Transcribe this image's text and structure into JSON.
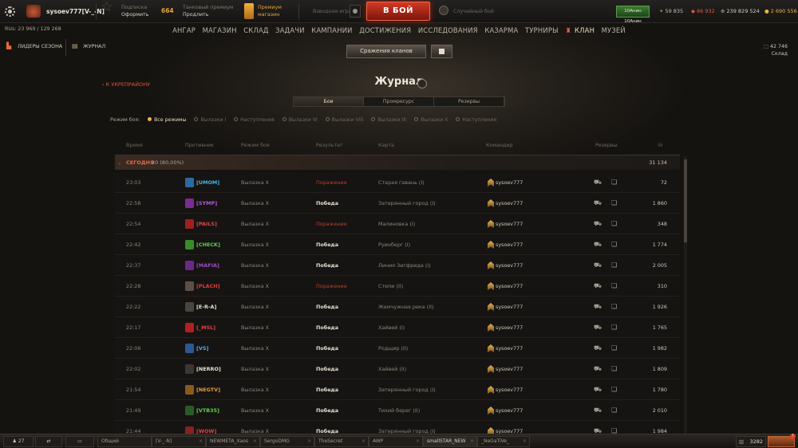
{
  "topbar": {
    "player_name": "sysoev777[V-_-N]",
    "subscription_line1": "Подписка",
    "subscription_line2": "Оформить",
    "premium_days": "664",
    "tank_premium_line1": "Танковый премиум",
    "tank_premium_line2": "Продлить",
    "premium_shop_line1": "Премиум",
    "premium_shop_line2": "магазин",
    "game_mode": "Взводная игра",
    "battle_button": "В БОЙ",
    "random_battle": "Случайный бой",
    "boost_label": "10Анин 10Анин",
    "currencies": [
      {
        "icon": "free-xp-icon",
        "value": "59 835",
        "color": "#c5c0b6"
      },
      {
        "icon": "bonds-icon",
        "value": "86 932",
        "color": "#e05a3a"
      },
      {
        "icon": "credits-icon",
        "value": "239 829 524",
        "color": "#d6cfbf"
      },
      {
        "icon": "gold-icon",
        "value": "2 690 556",
        "color": "#f0b53e"
      }
    ]
  },
  "ru": "RUs: 23 969 / 129 268",
  "nav": [
    "АНГАР",
    "МАГАЗИН",
    "СКЛАД",
    "ЗАДАЧИ",
    "КАМПАНИИ",
    "ДОСТИЖЕНИЯ",
    "ИССЛЕДОВАНИЯ",
    "КАЗАРМА",
    "ТУРНИРЫ",
    "КЛАН",
    "МУЗЕЙ"
  ],
  "left_panel": {
    "leaders": "ЛИДЕРЫ СЕЗОНА",
    "journal": "ЖУРНАЛ"
  },
  "storage": {
    "value": "42 746",
    "label": "Склад"
  },
  "clan_battles_button": "Сражения кланов",
  "back_link": "К УКРЕПРАЙОНУ",
  "page_title": "Журнал",
  "tabs": [
    "Бои",
    "Промресурс",
    "Резервы"
  ],
  "filter": {
    "label": "Режим боя:",
    "options": [
      "Все режимы",
      "Вылазки I",
      "Наступления",
      "Вылазки VI",
      "Вылазки VIII",
      "Вылазки IX",
      "Вылазки X",
      "Наступления"
    ]
  },
  "columns": [
    "Время",
    "Противник",
    "Режим боя",
    "Результат",
    "Карта",
    "Командир",
    "Резервы"
  ],
  "today": {
    "label": "СЕГОДНЯ",
    "stats": "20 (80,00%)",
    "total": "31 134"
  },
  "rows": [
    {
      "time": "23:03",
      "tag": "[UMOM]",
      "tag_color": "#44b7e8",
      "emblem": "#2c6aa0",
      "mode": "Вылазка X",
      "result": "Поражение",
      "res_class": "loss",
      "map": "Старая гавань (I)",
      "commander": "sysoev777",
      "value": "72"
    },
    {
      "time": "22:58",
      "tag": "[SYMP]",
      "tag_color": "#b258d8",
      "emblem": "#7a2c90",
      "mode": "Вылазка X",
      "result": "Победа",
      "res_class": "win",
      "map": "Затерянный город (I)",
      "commander": "sysoev777",
      "value": "1 860"
    },
    {
      "time": "22:54",
      "tag": "[PAILS]",
      "tag_color": "#e04545",
      "emblem": "#a02020",
      "mode": "Вылазка X",
      "result": "Поражение",
      "res_class": "loss",
      "map": "Малиновка (I)",
      "commander": "sysoev777",
      "value": "348"
    },
    {
      "time": "22:42",
      "tag": "[CHECK]",
      "tag_color": "#5fd04a",
      "emblem": "#3a8a2a",
      "mode": "Вылазка X",
      "result": "Победа",
      "res_class": "win",
      "map": "Руинберг (I)",
      "commander": "sysoev777",
      "value": "1 774"
    },
    {
      "time": "22:37",
      "tag": "[MAFIA]",
      "tag_color": "#a048c8",
      "emblem": "#6a2a8a",
      "mode": "Вылазка X",
      "result": "Победа",
      "res_class": "win",
      "map": "Линия Зигфрида (I)",
      "commander": "sysoev777",
      "value": "2 005"
    },
    {
      "time": "22:28",
      "tag": "[PLACH]",
      "tag_color": "#d84040",
      "emblem": "#5a5048",
      "mode": "Вылазка X",
      "result": "Поражение",
      "res_class": "loss",
      "map": "Степи (II)",
      "commander": "sysoev777",
      "value": "310"
    },
    {
      "time": "22:22",
      "tag": "[E-R-A]",
      "tag_color": "#e5dfd1",
      "emblem": "#4a4540",
      "mode": "Вылазка X",
      "result": "Победа",
      "res_class": "win",
      "map": "Жемчужная река (II)",
      "commander": "sysoev777",
      "value": "1 926"
    },
    {
      "time": "22:17",
      "tag": "[_MSL]",
      "tag_color": "#e04040",
      "emblem": "#b02020",
      "mode": "Вылазка X",
      "result": "Победа",
      "res_class": "win",
      "map": "Хайвей (I)",
      "commander": "sysoev777",
      "value": "1 765"
    },
    {
      "time": "22:06",
      "tag": "[VS]",
      "tag_color": "#5aa8e8",
      "emblem": "#2a5a90",
      "mode": "Вылазка X",
      "result": "Победа",
      "res_class": "win",
      "map": "Родщир (II)",
      "commander": "sysoev777",
      "value": "1 982"
    },
    {
      "time": "22:02",
      "tag": "[NERRO]",
      "tag_color": "#e5dfd1",
      "emblem": "#3a3632",
      "mode": "Вылазка X",
      "result": "Победа",
      "res_class": "win",
      "map": "Хайвей (II)",
      "commander": "sysoev777",
      "value": "1 809"
    },
    {
      "time": "21:54",
      "tag": "[NEGTV]",
      "tag_color": "#e89a3a",
      "emblem": "#8a5a1a",
      "mode": "Вылазка X",
      "result": "Победа",
      "res_class": "win",
      "map": "Затерянный город (I)",
      "commander": "sysoev777",
      "value": "1 780"
    },
    {
      "time": "21:49",
      "tag": "[VTB35]",
      "tag_color": "#5fd04a",
      "emblem": "#2a5a28",
      "mode": "Вылазка X",
      "result": "Победа",
      "res_class": "win",
      "map": "Тихий берег (II)",
      "commander": "sysoev777",
      "value": "2 010"
    },
    {
      "time": "21:44",
      "tag": "[WOW]",
      "tag_color": "#e04545",
      "emblem": "#8a2020",
      "mode": "Вылазка X",
      "result": "Победа",
      "res_class": "win",
      "map": "Затерянный город (I)",
      "commander": "sysoev777",
      "value": "1 984"
    }
  ],
  "bottom": {
    "online": "27",
    "channels": [
      "Общий",
      "[V-_-N]",
      "NEWMETA_Xaos",
      "SergoDMG",
      "TheSecret",
      "AWP",
      "smallSTAR_NEW",
      "_NeGaTiVe_"
    ],
    "queue": "3282"
  }
}
